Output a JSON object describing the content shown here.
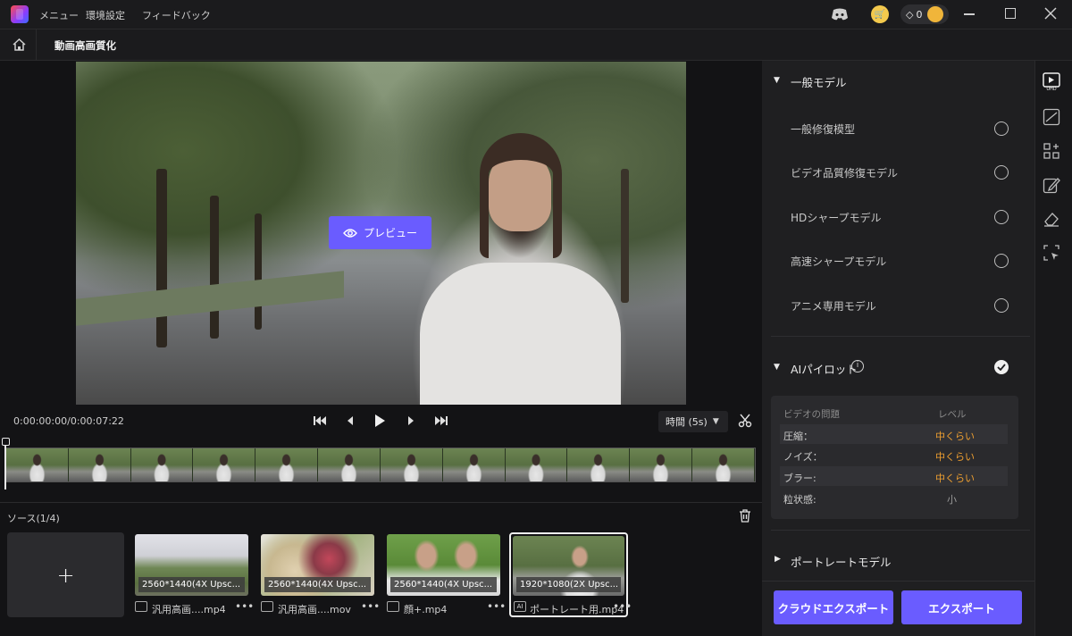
{
  "menubar": {
    "menu": "メニュー",
    "settings": "環境設定",
    "feedback": "フィードバック",
    "gem_count": "0"
  },
  "subbar": {
    "title": "動画高画質化"
  },
  "preview": {
    "button_label": "プレビュー"
  },
  "player": {
    "timecode": "0:00:00:00/0:00:07:22",
    "interval_label": "時間 (5s)"
  },
  "sources": {
    "header": "ソース(1/4)",
    "items": [
      {
        "label": "2560*1440(4X Upsc...",
        "name": "汎用高画....mp4"
      },
      {
        "label": "2560*1440(4X Upsc...",
        "name": "汎用高画....mov"
      },
      {
        "label": "2560*1440(4X Upsc...",
        "name": "顔+.mp4"
      },
      {
        "label": "1920*1080(2X Upsc...",
        "name": "ポートレート用.mp4"
      }
    ]
  },
  "panel": {
    "general_section": "一般モデル",
    "models": [
      "一般修復模型",
      "ビデオ品質修復モデル",
      "HDシャープモデル",
      "高速シャープモデル",
      "アニメ専用モデル"
    ],
    "ai_section": "AIパイロット",
    "ai_table": {
      "col_issue": "ビデオの問題",
      "col_level": "レベル",
      "rows": [
        {
          "issue": "圧縮：",
          "level": "中くらい"
        },
        {
          "issue": "ノイズ：",
          "level": "中くらい"
        },
        {
          "issue": "ブラー:",
          "level": "中くらい"
        },
        {
          "issue": "粒状感:",
          "level": "小"
        }
      ]
    },
    "portrait_section": "ポートレートモデル",
    "cloud_export": "クラウドエクスポート",
    "export": "エクスポート"
  },
  "colors": {
    "accent": "#6a5cff",
    "level_medium": "#f0a030",
    "level_low": "#9a9a9a"
  }
}
